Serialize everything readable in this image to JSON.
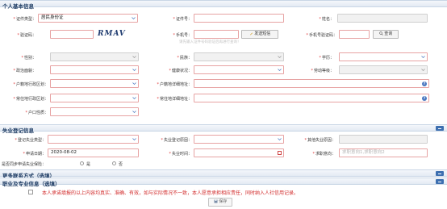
{
  "sections": {
    "personal": "个人基本信息",
    "unemployment": "失业登记信息",
    "contact": "更多联系方式（选填）",
    "career": "职业及专业信息（选填）"
  },
  "personal": {
    "id_type_label": "证件类型",
    "id_type_value": "居民身份证",
    "id_number_label": "证件号",
    "id_number_value": "",
    "name_label": "姓名",
    "name_value": "",
    "captcha_label": "验证码",
    "captcha_value": "",
    "captcha_text": "RMAV",
    "phone_label": "手机号",
    "phone_value": "",
    "send_code_label": "发送短信",
    "phone_code_label": "手机号验证码",
    "phone_code_value": "",
    "query_label": "查询",
    "hint": "请先输入证件号码验证后再进行查询！",
    "gender_label": "性别",
    "nation_label": "民族",
    "education_label": "学历",
    "political_label": "政治面貌",
    "health_label": "健康状况",
    "labor_label": "劳动等级",
    "huji_region_label": "户籍地行政区划",
    "huji_address_label": "户籍地详细地址",
    "residence_region_label": "常住地行政区划",
    "residence_address_label": "常住地详细地址",
    "huji_nature_label": "户口性质"
  },
  "unemployment": {
    "reg_type_label": "登记失业类型",
    "reg_reason_label": "失业登记原因",
    "other_reason_label": "其他失业原因",
    "apply_date_label": "申请日期",
    "apply_date_value": "2020-08-02",
    "unemployed_time_label": "失业时间",
    "job_intent_label": "求职意向",
    "job_intent_placeholder": "求职意向1,求职意向2",
    "insurance_question": "是否同步申请失业保险：",
    "yes_label": "是",
    "no_label": "否"
  },
  "footer": {
    "commitment": "本人承诺填报的以上内容均真实、准确、有效，如与实际情况不一致，本人愿意承担相应责任，同时纳入人社信用记录。",
    "save_label": "保存"
  },
  "colors": {
    "required_border": "#e7a3a3",
    "section_title": "#1d3b63",
    "accent": "#3d6fb0",
    "warning_text": "#d22c2c"
  }
}
